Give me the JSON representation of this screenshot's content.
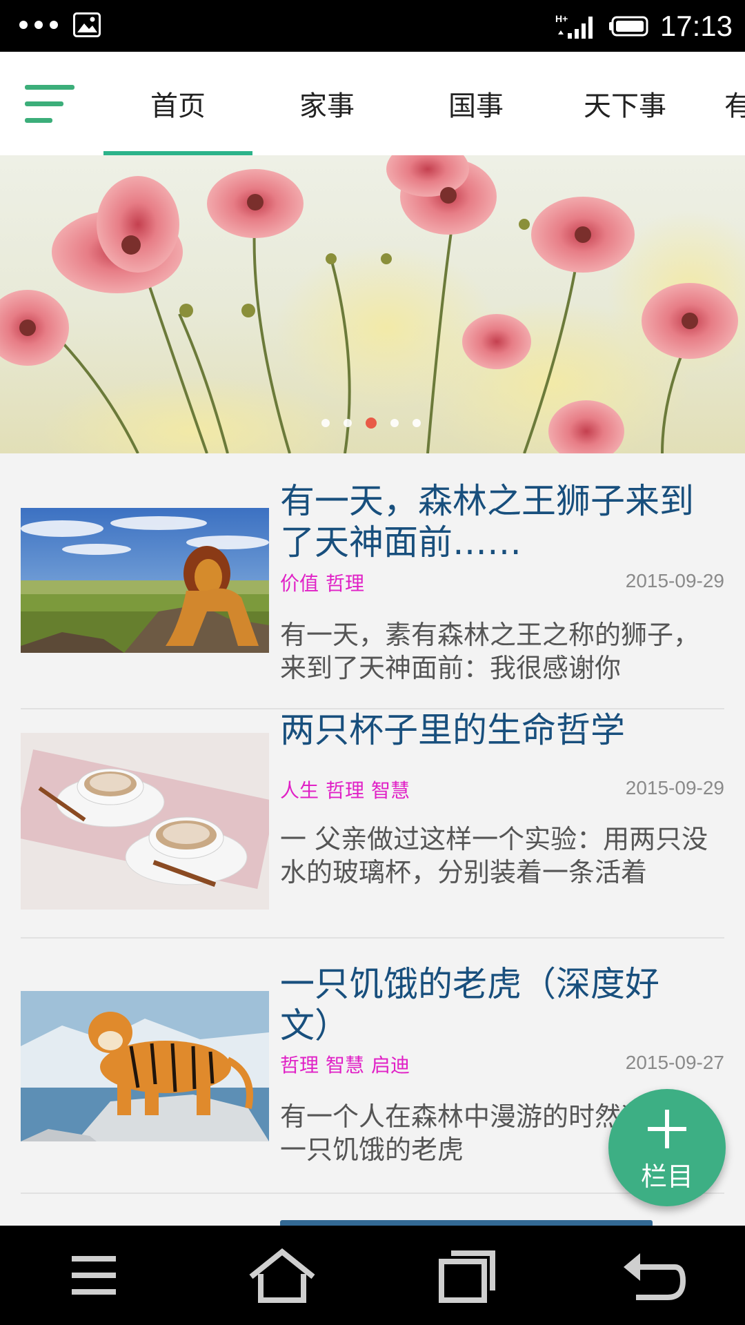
{
  "status_bar": {
    "time": "17:13",
    "icons": [
      "more-dots-icon",
      "gallery-notification-icon",
      "hplus-signal-icon",
      "battery-icon"
    ]
  },
  "top_bar": {
    "menu_icon": "hamburger-menu-icon",
    "tabs": [
      {
        "label": "首页",
        "active": true
      },
      {
        "label": "家事",
        "active": false
      },
      {
        "label": "国事",
        "active": false
      },
      {
        "label": "天下事",
        "active": false
      },
      {
        "label": "有",
        "active": false
      }
    ],
    "accent_color": "#2cb38a"
  },
  "banner": {
    "image": "pink-cosmos-flowers-photo",
    "page_count": 5,
    "current_page": 3
  },
  "articles": [
    {
      "title": "有一天，森林之王狮子来到了天神面前……",
      "tags": [
        "价值",
        "哲理"
      ],
      "date": "2015-09-29",
      "summary": "有一天，素有森林之王之称的狮子，来到了天神面前：我很感谢你",
      "thumbnail": "lion-king-illustration"
    },
    {
      "title": "两只杯子里的生命哲学",
      "tags": [
        "人生",
        "哲理",
        "智慧"
      ],
      "date": "2015-09-29",
      "summary": "一 父亲做过这样一个实验：用两只没水的玻璃杯，分别装着一条活着",
      "thumbnail": "two-coffee-cups-photo"
    },
    {
      "title": "一只饥饿的老虎（深度好文）",
      "tags": [
        "哲理",
        "智慧",
        "启迪"
      ],
      "date": "2015-09-27",
      "summary": "有一个人在森林中漫游的时然遇见了一只饥饿的老虎",
      "thumbnail": "tiger-painting"
    }
  ],
  "fab": {
    "icon": "plus-icon",
    "label": "栏目",
    "color": "#3daf84"
  },
  "nav_bar": {
    "buttons": [
      "menu-icon",
      "home-icon",
      "recent-apps-icon",
      "back-icon"
    ]
  },
  "colors": {
    "title": "#184f7d",
    "tag": "#e020c6",
    "date": "#8a8a8a"
  }
}
